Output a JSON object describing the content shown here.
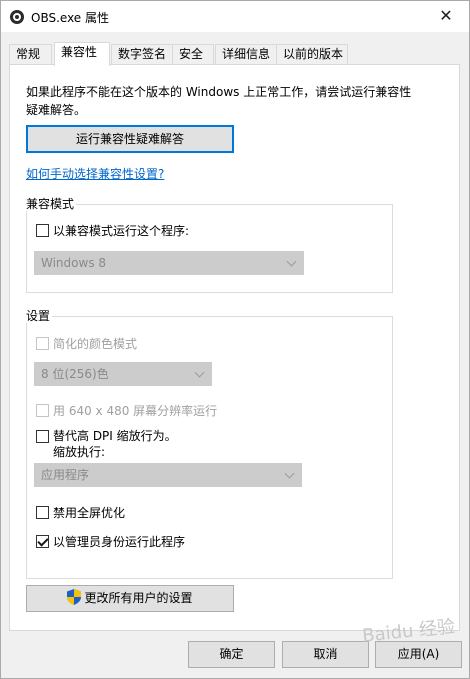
{
  "window": {
    "title": "OBS.exe 属性",
    "close_glyph": "✕"
  },
  "tabs": [
    {
      "label": "常规"
    },
    {
      "label": "兼容性"
    },
    {
      "label": "数字签名"
    },
    {
      "label": "安全"
    },
    {
      "label": "详细信息"
    },
    {
      "label": "以前的版本"
    }
  ],
  "active_tab": "兼容性",
  "intro_text": "如果此程序不能在这个版本的 Windows 上正常工作，请尝试运行兼容性疑难解答。",
  "troubleshoot_button": "运行兼容性疑难解答",
  "manual_link": "如何手动选择兼容性设置?",
  "compat_mode": {
    "label": "兼容模式",
    "checkbox_label": "以兼容模式运行这个程序:",
    "checked": false,
    "select_value": "Windows 8"
  },
  "settings": {
    "label": "设置",
    "reduced_color": {
      "label": "简化的颜色模式",
      "checked": false,
      "enabled": false
    },
    "color_select_value": "8 位(256)色",
    "res_640": {
      "label": "用 640 x 480 屏幕分辨率运行",
      "checked": false,
      "enabled": false
    },
    "dpi_override": {
      "label": "替代高 DPI 缩放行为。",
      "sublabel": "缩放执行:",
      "checked": false
    },
    "dpi_select_value": "应用程序",
    "disable_fullscreen": {
      "label": "禁用全屏优化",
      "checked": false
    },
    "run_as_admin": {
      "label": "以管理员身份运行此程序",
      "checked": true
    }
  },
  "all_users_button": "更改所有用户的设置",
  "footer": {
    "ok": "确定",
    "cancel": "取消",
    "apply": "应用(A)"
  },
  "watermark": "Baidu 经验",
  "colors": {
    "accent": "#0078d7",
    "link": "#0066cc"
  }
}
